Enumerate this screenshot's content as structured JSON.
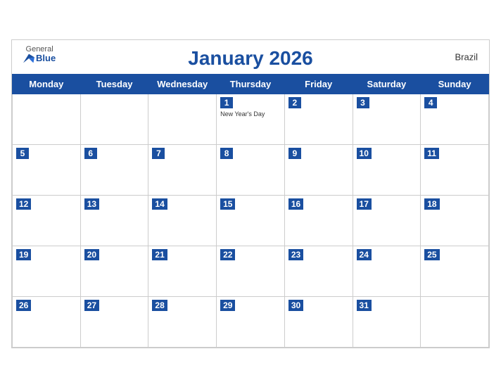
{
  "header": {
    "title": "January 2026",
    "country": "Brazil",
    "logo": {
      "general": "General",
      "blue": "Blue"
    }
  },
  "days_of_week": [
    "Monday",
    "Tuesday",
    "Wednesday",
    "Thursday",
    "Friday",
    "Saturday",
    "Sunday"
  ],
  "weeks": [
    [
      null,
      null,
      null,
      {
        "num": 1,
        "holiday": "New Year's Day"
      },
      {
        "num": 2
      },
      {
        "num": 3
      },
      {
        "num": 4
      }
    ],
    [
      {
        "num": 5
      },
      {
        "num": 6
      },
      {
        "num": 7
      },
      {
        "num": 8
      },
      {
        "num": 9
      },
      {
        "num": 10
      },
      {
        "num": 11
      }
    ],
    [
      {
        "num": 12
      },
      {
        "num": 13
      },
      {
        "num": 14
      },
      {
        "num": 15
      },
      {
        "num": 16
      },
      {
        "num": 17
      },
      {
        "num": 18
      }
    ],
    [
      {
        "num": 19
      },
      {
        "num": 20
      },
      {
        "num": 21
      },
      {
        "num": 22
      },
      {
        "num": 23
      },
      {
        "num": 24
      },
      {
        "num": 25
      }
    ],
    [
      {
        "num": 26
      },
      {
        "num": 27
      },
      {
        "num": 28
      },
      {
        "num": 29
      },
      {
        "num": 30
      },
      {
        "num": 31
      },
      null
    ]
  ]
}
